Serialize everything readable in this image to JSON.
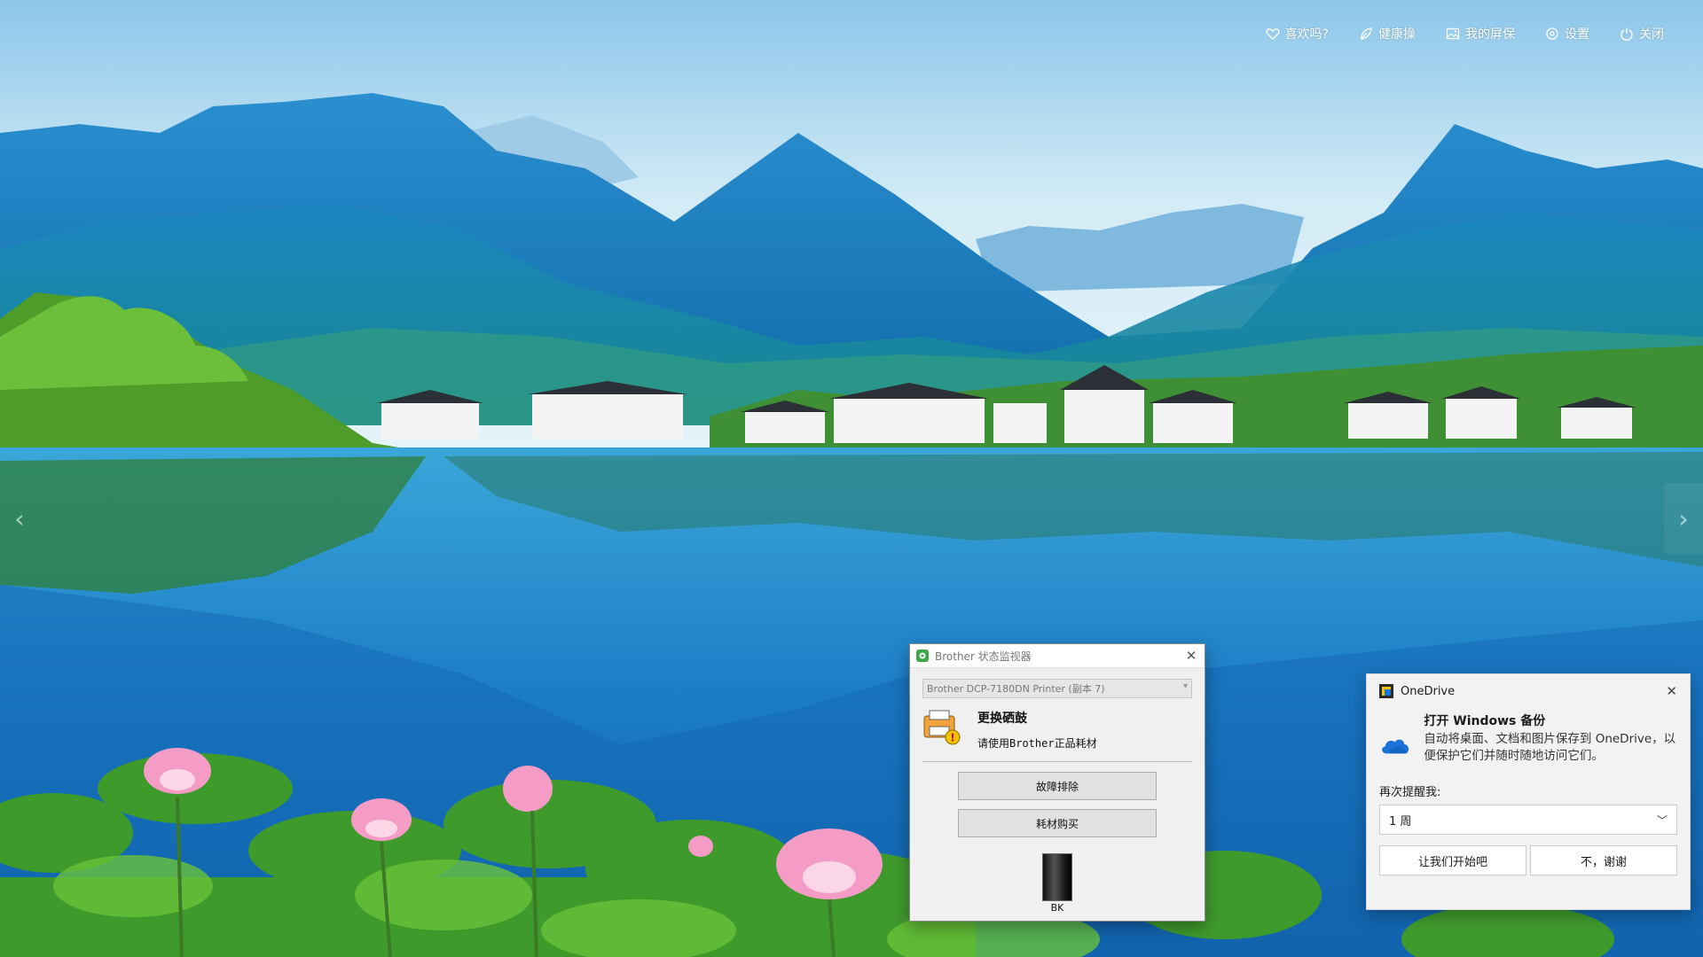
{
  "toolbar": {
    "items": [
      {
        "label": "喜欢吗?",
        "icon": "heart-icon"
      },
      {
        "label": "健康操",
        "icon": "leaf-icon"
      },
      {
        "label": "我的屏保",
        "icon": "image-icon"
      },
      {
        "label": "设置",
        "icon": "gear-icon"
      },
      {
        "label": "关闭",
        "icon": "power-icon"
      }
    ]
  },
  "brother_dialog": {
    "title": "Brother 状态监视器",
    "printer_select": "Brother DCP-7180DN Printer (副本 7)",
    "status_title": "更换硒鼓",
    "status_message": "请使用Brother正品耗材",
    "troubleshoot_label": "故障排除",
    "buy_supplies_label": "耗材购买",
    "ink_label": "BK"
  },
  "onedrive_toast": {
    "app_name": "OneDrive",
    "title": "打开 Windows 备份",
    "description": "自动将桌面、文档和图片保存到 OneDrive，以便保护它们并随时随地访问它们。",
    "remind_label": "再次提醒我:",
    "remind_value": "1 周",
    "primary_button": "让我们开始吧",
    "secondary_button": "不，谢谢"
  },
  "colors": {
    "sky": "#bfe0f0",
    "mountain": "#1f7fc2",
    "lake": "#1f7fc4",
    "onedrive_blue": "#1a73d9"
  }
}
